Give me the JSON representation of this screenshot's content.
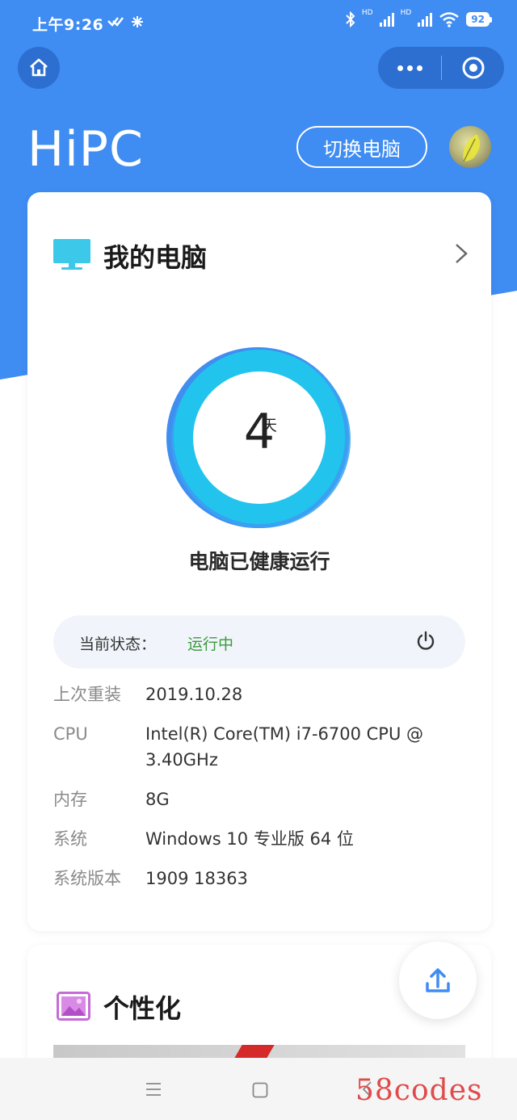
{
  "status_bar": {
    "time": "上午9:26",
    "network_label_1": "HD",
    "network_label_2": "HD",
    "battery": "92"
  },
  "header": {
    "app_title": "HiPC",
    "switch_button": "切换电脑"
  },
  "pc_card": {
    "title": "我的电脑",
    "days_value": "4",
    "days_unit": "天",
    "health_text": "电脑已健康运行",
    "state_label": "当前状态：",
    "state_value": "运行中",
    "info": [
      {
        "key": "上次重装",
        "value": "2019.10.28"
      },
      {
        "key": "CPU",
        "value": "Intel(R) Core(TM) i7-6700 CPU @ 3.40GHz"
      },
      {
        "key": "内存",
        "value": "8G"
      },
      {
        "key": "系统",
        "value": "Windows 10 专业版 64 位"
      },
      {
        "key": "系统版本",
        "value": "1909 18363"
      }
    ]
  },
  "personal_card": {
    "title": "个性化"
  },
  "watermark": "58codes",
  "colors": {
    "primary_blue": "#3f8cf2",
    "ring_cyan": "#20c8ee",
    "running_green": "#3a9a3a"
  }
}
